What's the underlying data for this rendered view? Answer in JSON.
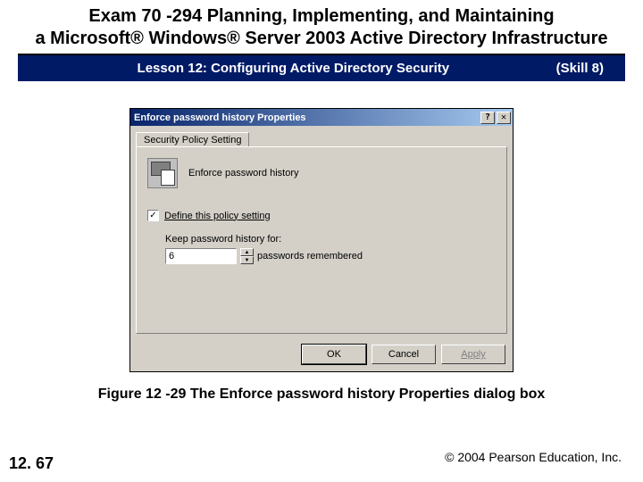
{
  "title_line1": "Exam 70 -294 Planning, Implementing, and Maintaining",
  "title_line2": "a Microsoft® Windows® Server 2003 Active Directory Infrastructure",
  "band": {
    "lesson": "Lesson 12: Configuring Active Directory Security",
    "skill": "(Skill 8)"
  },
  "dialog": {
    "title": "Enforce password history Properties",
    "help_label": "?",
    "close_label": "✕",
    "tab": "Security Policy Setting",
    "policy_name": "Enforce password history",
    "checkbox_checked": "✓",
    "checkbox_label": "Define this policy setting",
    "keep_label": "Keep password history for:",
    "value": "6",
    "unit": "passwords remembered",
    "spin_up": "▲",
    "spin_down": "▼",
    "ok": "OK",
    "cancel": "Cancel",
    "apply": "Apply"
  },
  "caption": "Figure 12 -29 The Enforce password history Properties dialog box",
  "page_number": "12. 67",
  "copyright": "© 2004 Pearson Education, Inc."
}
